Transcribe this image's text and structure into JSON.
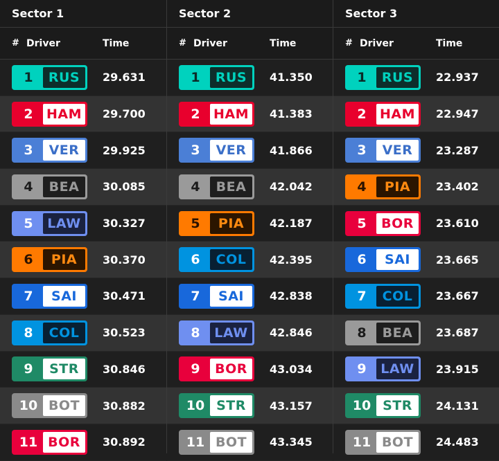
{
  "teams": {
    "MER": {
      "bg": "#00d2be",
      "num": "#0b2a27",
      "code_bg": "#0d2e2b",
      "code_fg": "#00d2be"
    },
    "FER": {
      "bg": "#e8002d",
      "num": "#ffffff",
      "code_bg": "#ffffff",
      "code_fg": "#e8002d"
    },
    "RBR": {
      "bg": "#4b7fd6",
      "num": "#ffffff",
      "code_bg": "#ffffff",
      "code_fg": "#3b6fc8"
    },
    "HAA": {
      "bg": "#9a9a9a",
      "num": "#1b1b1b",
      "code_bg": "#1e1e1e",
      "code_fg": "#9a9a9a"
    },
    "RB": {
      "bg": "#6f8ff0",
      "num": "#ffffff",
      "code_bg": "#1a2240",
      "code_fg": "#6f8ff0"
    },
    "MCL": {
      "bg": "#ff7a00",
      "num": "#2b1200",
      "code_bg": "#2b1500",
      "code_fg": "#ff8a10"
    },
    "WIL": {
      "bg": "#1868db",
      "num": "#ffffff",
      "code_bg": "#ffffff",
      "code_fg": "#1868db"
    },
    "ALP": {
      "bg": "#0093e0",
      "num": "#ffffff",
      "code_bg": "#082033",
      "code_fg": "#0093e0"
    },
    "AST": {
      "bg": "#1f8a66",
      "num": "#ffffff",
      "code_bg": "#ffffff",
      "code_fg": "#1f8a66"
    },
    "SAU": {
      "bg": "#8a8a8a",
      "num": "#ffffff",
      "code_bg": "#ffffff",
      "code_fg": "#8a8a8a"
    },
    "KIC": {
      "bg": "#e8003c",
      "num": "#ffffff",
      "code_bg": "#ffffff",
      "code_fg": "#e8003c"
    }
  },
  "header": {
    "pos": "#",
    "driver": "Driver",
    "time": "Time"
  },
  "sectors": [
    {
      "title": "Sector 1",
      "rows": [
        {
          "pos": "1",
          "code": "RUS",
          "time": "29.631",
          "team": "MER"
        },
        {
          "pos": "2",
          "code": "HAM",
          "time": "29.700",
          "team": "FER"
        },
        {
          "pos": "3",
          "code": "VER",
          "time": "29.925",
          "team": "RBR"
        },
        {
          "pos": "4",
          "code": "BEA",
          "time": "30.085",
          "team": "HAA"
        },
        {
          "pos": "5",
          "code": "LAW",
          "time": "30.327",
          "team": "RB"
        },
        {
          "pos": "6",
          "code": "PIA",
          "time": "30.370",
          "team": "MCL"
        },
        {
          "pos": "7",
          "code": "SAI",
          "time": "30.471",
          "team": "WIL"
        },
        {
          "pos": "8",
          "code": "COL",
          "time": "30.523",
          "team": "ALP"
        },
        {
          "pos": "9",
          "code": "STR",
          "time": "30.846",
          "team": "AST"
        },
        {
          "pos": "10",
          "code": "BOT",
          "time": "30.882",
          "team": "SAU"
        },
        {
          "pos": "11",
          "code": "BOR",
          "time": "30.892",
          "team": "KIC"
        }
      ]
    },
    {
      "title": "Sector 2",
      "rows": [
        {
          "pos": "1",
          "code": "RUS",
          "time": "41.350",
          "team": "MER"
        },
        {
          "pos": "2",
          "code": "HAM",
          "time": "41.383",
          "team": "FER"
        },
        {
          "pos": "3",
          "code": "VER",
          "time": "41.866",
          "team": "RBR"
        },
        {
          "pos": "4",
          "code": "BEA",
          "time": "42.042",
          "team": "HAA"
        },
        {
          "pos": "5",
          "code": "PIA",
          "time": "42.187",
          "team": "MCL"
        },
        {
          "pos": "6",
          "code": "COL",
          "time": "42.395",
          "team": "ALP"
        },
        {
          "pos": "7",
          "code": "SAI",
          "time": "42.838",
          "team": "WIL"
        },
        {
          "pos": "8",
          "code": "LAW",
          "time": "42.846",
          "team": "RB"
        },
        {
          "pos": "9",
          "code": "BOR",
          "time": "43.034",
          "team": "KIC"
        },
        {
          "pos": "10",
          "code": "STR",
          "time": "43.157",
          "team": "AST"
        },
        {
          "pos": "11",
          "code": "BOT",
          "time": "43.345",
          "team": "SAU"
        }
      ]
    },
    {
      "title": "Sector 3",
      "rows": [
        {
          "pos": "1",
          "code": "RUS",
          "time": "22.937",
          "team": "MER"
        },
        {
          "pos": "2",
          "code": "HAM",
          "time": "22.947",
          "team": "FER"
        },
        {
          "pos": "3",
          "code": "VER",
          "time": "23.287",
          "team": "RBR"
        },
        {
          "pos": "4",
          "code": "PIA",
          "time": "23.402",
          "team": "MCL"
        },
        {
          "pos": "5",
          "code": "BOR",
          "time": "23.610",
          "team": "KIC"
        },
        {
          "pos": "6",
          "code": "SAI",
          "time": "23.665",
          "team": "WIL"
        },
        {
          "pos": "7",
          "code": "COL",
          "time": "23.667",
          "team": "ALP"
        },
        {
          "pos": "8",
          "code": "BEA",
          "time": "23.687",
          "team": "HAA"
        },
        {
          "pos": "9",
          "code": "LAW",
          "time": "23.915",
          "team": "RB"
        },
        {
          "pos": "10",
          "code": "STR",
          "time": "24.131",
          "team": "AST"
        },
        {
          "pos": "11",
          "code": "BOT",
          "time": "24.483",
          "team": "SAU"
        }
      ]
    }
  ]
}
